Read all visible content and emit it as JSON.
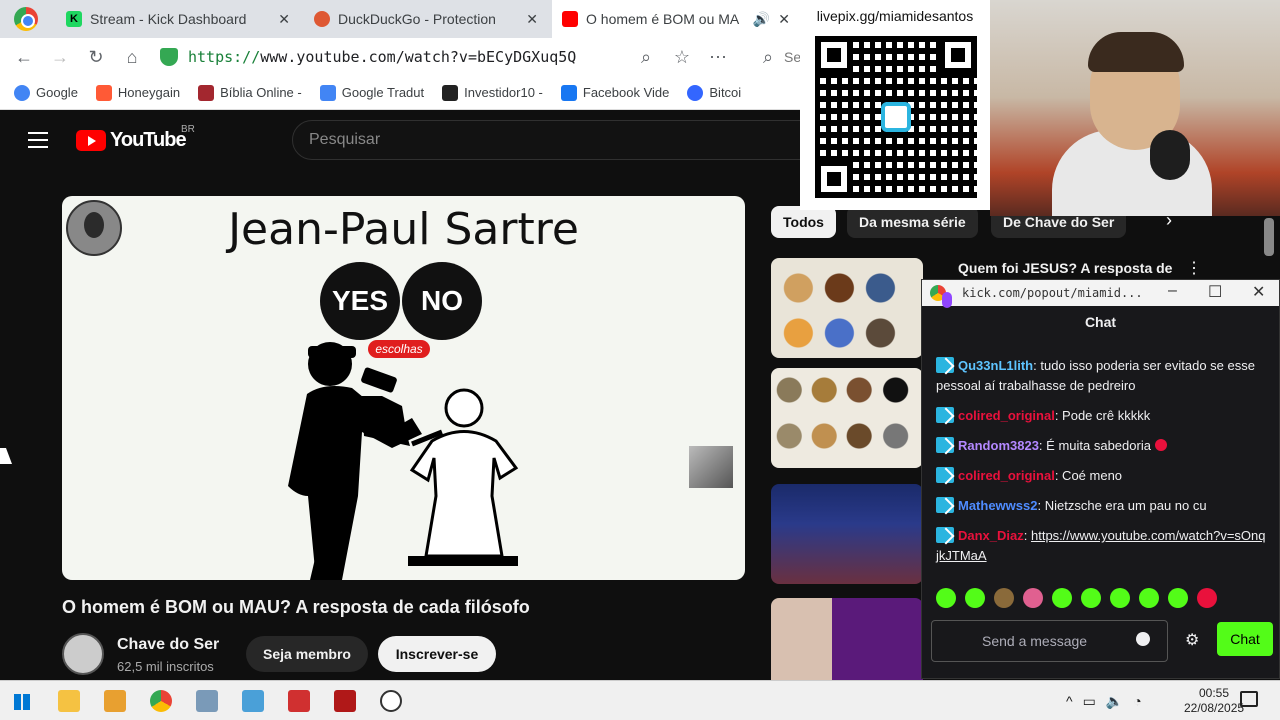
{
  "browser": {
    "tabs": [
      {
        "title": "Stream - Kick Dashboard",
        "close": "✕"
      },
      {
        "title": "DuckDuckGo - Protection",
        "close": "✕"
      },
      {
        "title": "O homem é BOM ou MA",
        "close": "✕"
      }
    ],
    "url_scheme": "https://",
    "url_rest": "www.youtube.com/watch?v=bECyDGXuq5Q",
    "search_hint": "Se"
  },
  "bookmarks": [
    {
      "label": "Google",
      "color": "#4285f4"
    },
    {
      "label": "Honeygain",
      "color": "#ff5a36"
    },
    {
      "label": "Bíblia Online -",
      "color": "#a3272f"
    },
    {
      "label": "Google Tradut",
      "color": "#4285f4"
    },
    {
      "label": "Investidor10 -",
      "color": "#222222"
    },
    {
      "label": "Facebook Vide",
      "color": "#1877f2"
    },
    {
      "label": "Bitcoi",
      "color": "#3366ff"
    }
  ],
  "youtube": {
    "logo_text": "YouTube",
    "country": "BR",
    "search_placeholder": "Pesquisar"
  },
  "player": {
    "title": "Jean-Paul Sartre",
    "yes": "YES",
    "no": "NO",
    "choice_label": "escolhas"
  },
  "video": {
    "title": "O homem é BOM ou MAU? A resposta de cada filósofo",
    "channel": "Chave do Ser",
    "subscribers": "62,5 mil inscritos",
    "member_label": "Seja membro",
    "subscribe_label": "Inscrever-se"
  },
  "filters": {
    "chips": [
      "Todos",
      "Da mesma série",
      "De Chave do Ser"
    ],
    "next": "›"
  },
  "recommendation": {
    "title": "Quem foi JESUS? A resposta de",
    "menu": "⋮"
  },
  "chat": {
    "window_url": "kick.com/popout/miamid...",
    "header": "Chat",
    "messages": [
      {
        "user": "Qu33nL1lith",
        "color": "#5ec4ff",
        "text": " tudo isso poderia ser evitado se esse pessoal aí trabalhasse de pedreiro"
      },
      {
        "user": "colired_original",
        "color": "#e9113c",
        "text": " Pode crê kkkkk"
      },
      {
        "user": "Random3823",
        "color": "#b388ff",
        "text": " É muita sabedoria"
      },
      {
        "user": "colired_original",
        "color": "#e9113c",
        "text": " Coé meno"
      },
      {
        "user": "Mathewwss2",
        "color": "#4f8cff",
        "text": " Nietzsche era um pau no cu"
      },
      {
        "user": "Danx_Diaz",
        "color": "#e9113c",
        "text": " ",
        "link": "https://www.youtube.com/watch?v=sOnqjkJTMaA"
      }
    ],
    "input_placeholder": "Send a message",
    "send_label": "Chat",
    "accent": "#53fc18"
  },
  "overlay": {
    "pix_label": "livepix.gg/miamidesantos"
  },
  "taskbar": {
    "time": "00:55",
    "date": "22/08/2025"
  }
}
